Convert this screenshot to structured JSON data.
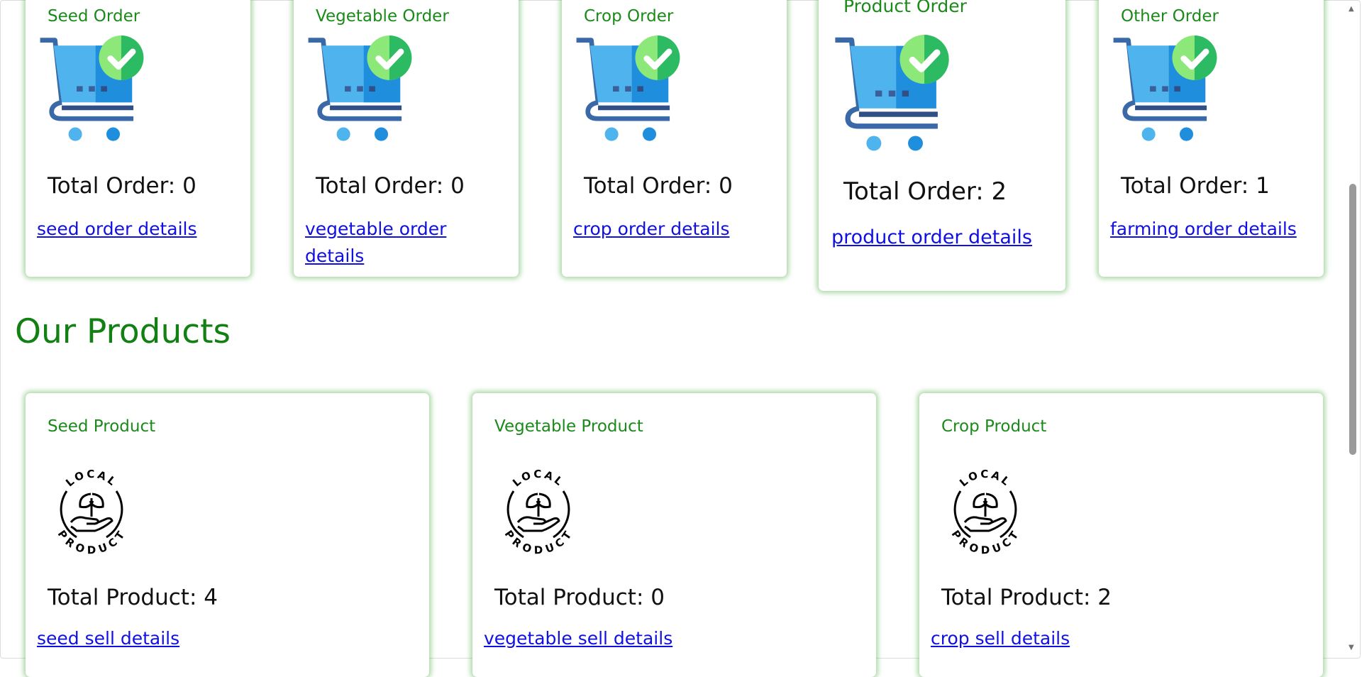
{
  "orders": [
    {
      "title": "Seed Order",
      "total": "Total Order: 0",
      "link": "seed order details"
    },
    {
      "title": "Vegetable Order",
      "total": "Total Order: 0",
      "link": "vegetable order details"
    },
    {
      "title": "Crop Order",
      "total": "Total Order: 0",
      "link": "crop order details"
    },
    {
      "title": "Product Order",
      "total": "Total Order: 2",
      "link": "product order details"
    },
    {
      "title": "Other Order",
      "total": "Total Order: 1",
      "link": "farming order details"
    }
  ],
  "products_section": {
    "title": "Our Products"
  },
  "products": [
    {
      "title": "Seed Product",
      "total": "Total Product: 4",
      "link": "seed sell details"
    },
    {
      "title": "Vegetable Product",
      "total": "Total Product: 0",
      "link": "vegetable sell details"
    },
    {
      "title": "Crop Product",
      "total": "Total Product: 2",
      "link": "crop sell details"
    }
  ],
  "icons": {
    "order": "shopping-cart-check-icon",
    "product": "local-product-badge-icon"
  },
  "colors": {
    "title_green": "#1b8a1b",
    "heading_green": "#128012",
    "link_blue": "#1010e0",
    "shadow_green": "#46aa3c"
  }
}
